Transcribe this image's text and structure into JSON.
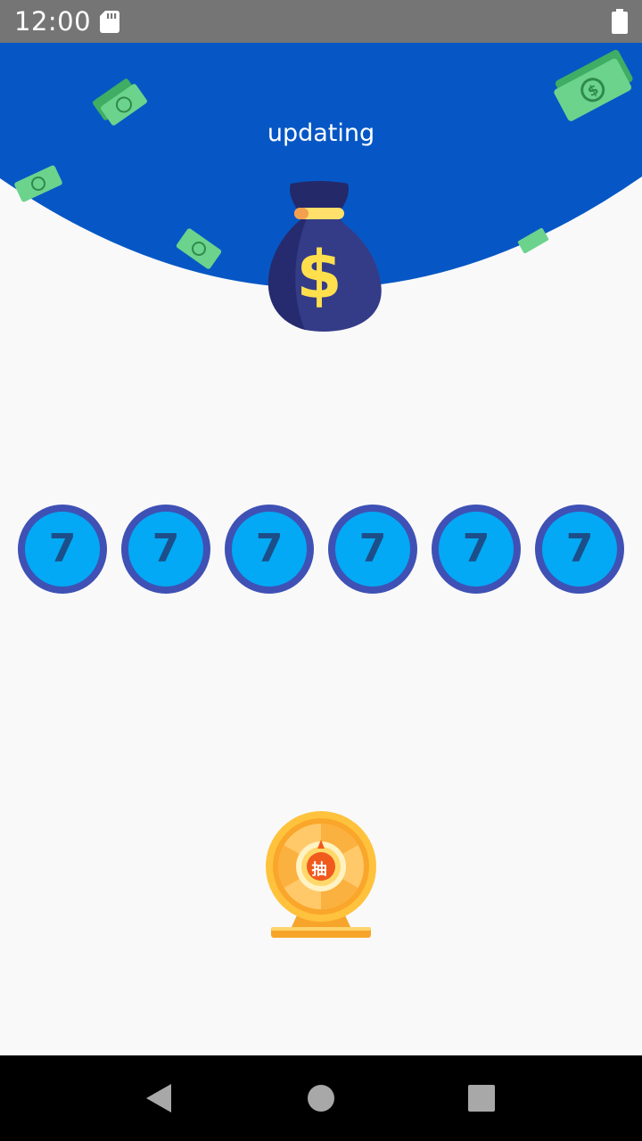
{
  "status_bar": {
    "time": "12:00",
    "icons": [
      "sd-card-icon",
      "battery-icon"
    ]
  },
  "header": {
    "title": "updating",
    "background_color": "#0657c5",
    "decoration_icons": [
      "money-bag-icon",
      "dollar-bill-icon"
    ]
  },
  "balls": [
    {
      "digit": "7"
    },
    {
      "digit": "7"
    },
    {
      "digit": "7"
    },
    {
      "digit": "7"
    },
    {
      "digit": "7"
    },
    {
      "digit": "7"
    }
  ],
  "ball_colors": {
    "fill": "#03a9f4",
    "ring": "#3f51b5",
    "digit": "#1c4f8a"
  },
  "draw_button": {
    "icon": "lucky-wheel-icon",
    "label": "抽"
  },
  "nav_bar": {
    "buttons": [
      "back-icon",
      "home-icon",
      "recents-icon"
    ]
  }
}
